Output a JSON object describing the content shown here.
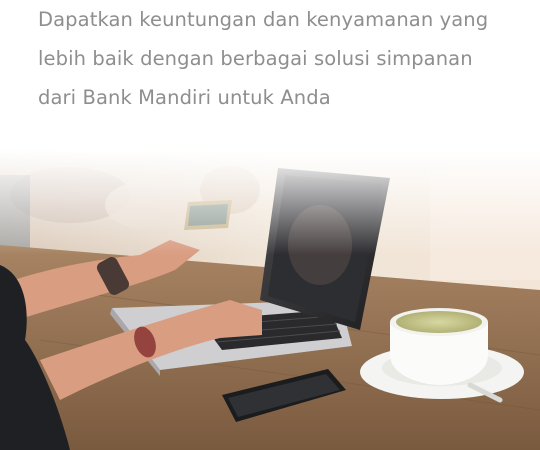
{
  "intro": {
    "lines": [
      "Dapatkan keuntungan dan kenyamanan yang",
      "lebih baik dengan berbagai solusi simpanan",
      "dari Bank Mandiri untuk Anda"
    ]
  },
  "hero": {
    "icon": "online-shopping-photo",
    "colors": {
      "table": "#8a6a4c",
      "laptop_lid": "#3a3a3c",
      "sleeve": "#1e2024",
      "skin": "#d99d82",
      "latte": "#c9c98a"
    }
  }
}
